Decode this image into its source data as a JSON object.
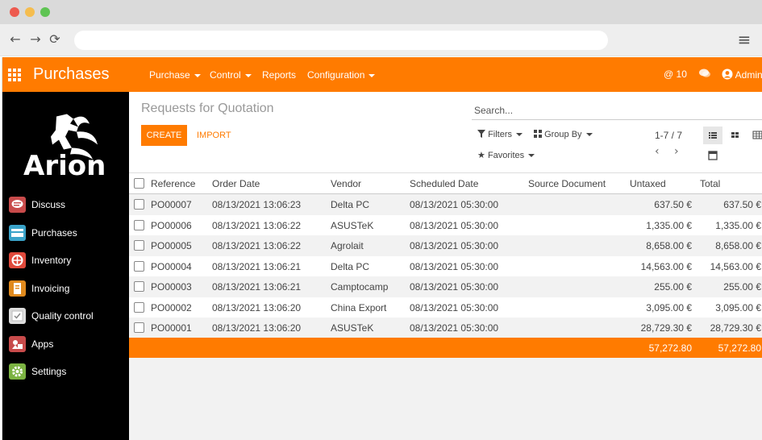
{
  "browser": {
    "dots": [
      "#ed5a4f",
      "#f5bd4f",
      "#5fc453"
    ],
    "back_glyph": "←",
    "forward_glyph": "→",
    "reload_glyph": "⟳",
    "menu_glyph": "≡"
  },
  "topbar": {
    "title": "Purchases",
    "menu": [
      "Purchase",
      "Control",
      "Reports",
      "Configuration"
    ],
    "activity_count": "@ 10",
    "user": "Admin",
    "accent": "#ff7b00"
  },
  "sidebar": {
    "logo_text": "Arion",
    "items": [
      {
        "label": "Discuss",
        "icon": "discuss-icon",
        "color": "#c84b4b"
      },
      {
        "label": "Purchases",
        "icon": "purchases-icon",
        "color": "#3aa3c9"
      },
      {
        "label": "Inventory",
        "icon": "inventory-icon",
        "color": "#e04a3c"
      },
      {
        "label": "Invoicing",
        "icon": "invoicing-icon",
        "color": "#e08a1e"
      },
      {
        "label": "Quality control",
        "icon": "quality-control-icon",
        "color": "#dddddd"
      },
      {
        "label": "Apps",
        "icon": "apps-icon",
        "color": "#c84b4b"
      },
      {
        "label": "Settings",
        "icon": "settings-icon",
        "color": "#7cb342"
      }
    ]
  },
  "control": {
    "breadcrumb": "Requests for Quotation",
    "create": "CREATE",
    "import": "IMPORT",
    "search_placeholder": "Search...",
    "filters": "Filters",
    "group_by": "Group By",
    "favorites": "Favorites",
    "pager": "1-7 / 7"
  },
  "table": {
    "headers": [
      "Reference",
      "Order Date",
      "Vendor",
      "Scheduled Date",
      "Source Document",
      "Untaxed",
      "Total"
    ],
    "rows": [
      {
        "ref": "PO00007",
        "order_date": "08/13/2021 13:06:23",
        "vendor": "Delta PC",
        "scheduled": "08/13/2021 05:30:00",
        "source": "",
        "untaxed": "637.50 €",
        "total": "637.50 €"
      },
      {
        "ref": "PO00006",
        "order_date": "08/13/2021 13:06:22",
        "vendor": "ASUSTeK",
        "scheduled": "08/13/2021 05:30:00",
        "source": "",
        "untaxed": "1,335.00 €",
        "total": "1,335.00 €"
      },
      {
        "ref": "PO00005",
        "order_date": "08/13/2021 13:06:22",
        "vendor": "Agrolait",
        "scheduled": "08/13/2021 05:30:00",
        "source": "",
        "untaxed": "8,658.00 €",
        "total": "8,658.00 €"
      },
      {
        "ref": "PO00004",
        "order_date": "08/13/2021 13:06:21",
        "vendor": "Delta PC",
        "scheduled": "08/13/2021 05:30:00",
        "source": "",
        "untaxed": "14,563.00 €",
        "total": "14,563.00 €"
      },
      {
        "ref": "PO00003",
        "order_date": "08/13/2021 13:06:21",
        "vendor": "Camptocamp",
        "scheduled": "08/13/2021 05:30:00",
        "source": "",
        "untaxed": "255.00 €",
        "total": "255.00 €"
      },
      {
        "ref": "PO00002",
        "order_date": "08/13/2021 13:06:20",
        "vendor": "China Export",
        "scheduled": "08/13/2021 05:30:00",
        "source": "",
        "untaxed": "3,095.00 €",
        "total": "3,095.00 €"
      },
      {
        "ref": "PO00001",
        "order_date": "08/13/2021 13:06:20",
        "vendor": "ASUSTeK",
        "scheduled": "08/13/2021 05:30:00",
        "source": "",
        "untaxed": "28,729.30 €",
        "total": "28,729.30 €"
      }
    ],
    "footer_untaxed": "57,272.80",
    "footer_total": "57,272.80"
  }
}
